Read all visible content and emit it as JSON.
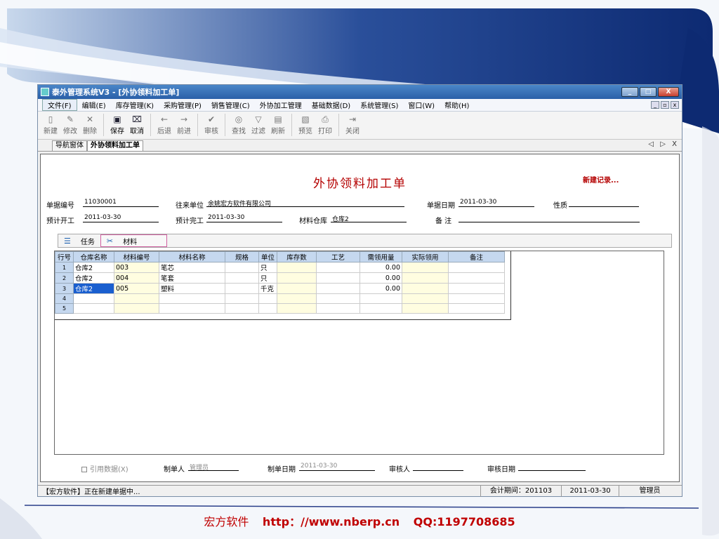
{
  "window": {
    "title": "泰外管理系统V3 - [外协领料加工单]",
    "controls": [
      "_",
      "□",
      "X"
    ]
  },
  "menu": [
    "文件(F)",
    "编辑(E)",
    "库存管理(K)",
    "采购管理(P)",
    "销售管理(C)",
    "外协加工管理",
    "基础数据(D)",
    "系统管理(S)",
    "窗口(W)",
    "帮助(H)"
  ],
  "toolbar": [
    {
      "label": "新建",
      "icon": "new-doc-icon",
      "glyph": "▯",
      "enabled": false
    },
    {
      "label": "修改",
      "icon": "edit-icon",
      "glyph": "✎",
      "enabled": false
    },
    {
      "label": "删除",
      "icon": "delete-icon",
      "glyph": "✕",
      "enabled": false
    },
    {
      "sep": true
    },
    {
      "label": "保存",
      "icon": "save-icon",
      "glyph": "▣",
      "enabled": true
    },
    {
      "label": "取消",
      "icon": "cancel-icon",
      "glyph": "⌧",
      "enabled": true
    },
    {
      "sep": true
    },
    {
      "label": "后退",
      "icon": "back-arrow-icon",
      "glyph": "←",
      "enabled": false
    },
    {
      "label": "前进",
      "icon": "forward-arrow-icon",
      "glyph": "→",
      "enabled": false
    },
    {
      "sep": true
    },
    {
      "label": "审核",
      "icon": "check-icon",
      "glyph": "✔",
      "enabled": false
    },
    {
      "sep": true
    },
    {
      "label": "查找",
      "icon": "binoculars-icon",
      "glyph": "◎",
      "enabled": false
    },
    {
      "label": "过滤",
      "icon": "filter-icon",
      "glyph": "▽",
      "enabled": false
    },
    {
      "label": "刷新",
      "icon": "refresh-icon",
      "glyph": "▤",
      "enabled": false
    },
    {
      "sep": true
    },
    {
      "label": "预览",
      "icon": "preview-icon",
      "glyph": "▧",
      "enabled": false
    },
    {
      "label": "打印",
      "icon": "print-icon",
      "glyph": "⎙",
      "enabled": false
    },
    {
      "sep": true
    },
    {
      "label": "关闭",
      "icon": "exit-icon",
      "glyph": "⇥",
      "enabled": false
    }
  ],
  "tabs": [
    "导航窗体",
    "外协领料加工单"
  ],
  "tab_nav": "◁ ▷ X",
  "form": {
    "title": "外协领料加工单",
    "status": "新建记录...",
    "doc_no_label": "单据编号",
    "doc_no": "11030001",
    "partner_label": "往来单位",
    "partner": "余姚宏方软件有限公司",
    "doc_date_label": "单据日期",
    "doc_date": "2011-03-30",
    "nature_label": "性质",
    "nature": "",
    "plan_start_label": "预计开工",
    "plan_start": "2011-03-30",
    "plan_end_label": "预计完工",
    "plan_end": "2011-03-30",
    "warehouse_label": "材料仓库",
    "warehouse": "仓库2",
    "remark_label": "备 注",
    "remark": ""
  },
  "subtabs": [
    {
      "label": "任务",
      "icon": "task-list-icon",
      "glyph": "☰"
    },
    {
      "label": "材料",
      "icon": "material-icon",
      "glyph": "✂"
    }
  ],
  "grid": {
    "columns": [
      "行号",
      "仓库名称",
      "材料编号",
      "材料名称",
      "规格",
      "单位",
      "库存数",
      "工艺",
      "需领用量",
      "实际领用",
      "备注"
    ],
    "rows": [
      [
        "1",
        "仓库2",
        "003",
        "笔芯",
        "",
        "只",
        "",
        "",
        "0.00",
        "",
        ""
      ],
      [
        "2",
        "仓库2",
        "004",
        "笔套",
        "",
        "只",
        "",
        "",
        "0.00",
        "",
        ""
      ],
      [
        "3",
        "仓库2",
        "005",
        "塑料",
        "",
        "千克",
        "",
        "",
        "0.00",
        "",
        ""
      ],
      [
        "4",
        "",
        "",
        "",
        "",
        "",
        "",
        "",
        "",
        "",
        ""
      ],
      [
        "5",
        "",
        "",
        "",
        "",
        "",
        "",
        "",
        "",
        "",
        ""
      ]
    ]
  },
  "bottom": {
    "ref_data": "引用数据(X)",
    "maker_label": "制单人",
    "maker": "管理员",
    "make_date_label": "制单日期",
    "make_date": "2011-03-30",
    "auditor_label": "审核人",
    "auditor": "",
    "audit_date_label": "审核日期",
    "audit_date": ""
  },
  "statusbar": {
    "message": "【宏方软件】正在新建单据中...",
    "period": "会计期间：201103",
    "date": "2011-03-30",
    "user": "管理员"
  },
  "footer": {
    "company": "宏方软件",
    "url": "http：//www.nberp.cn",
    "qq": "QQ:1197708685"
  },
  "colors": {
    "title_red": "#b40000",
    "grid_header": "#c5d8ef",
    "selected_cell": "#1a5fcf",
    "footer_red": "#c00000"
  }
}
